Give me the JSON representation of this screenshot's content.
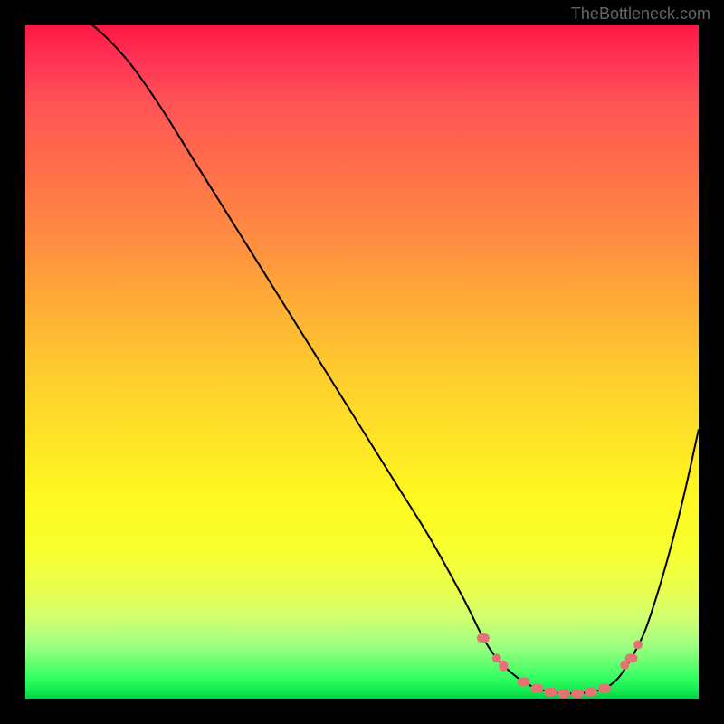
{
  "watermark": "TheBottleneck.com",
  "chart_data": {
    "type": "line",
    "title": "",
    "xlabel": "",
    "ylabel": "",
    "xlim": [
      0,
      100
    ],
    "ylim": [
      0,
      100
    ],
    "curve": {
      "description": "Bottleneck percentage curve",
      "x": [
        0,
        5,
        10,
        15,
        20,
        25,
        30,
        35,
        40,
        45,
        50,
        55,
        60,
        65,
        68,
        70,
        72,
        74,
        76,
        78,
        80,
        82,
        84,
        86,
        88,
        90,
        92,
        94,
        96,
        98,
        100
      ],
      "y": [
        105,
        103,
        100,
        95,
        88,
        80,
        72,
        64,
        56,
        48,
        40,
        32,
        24,
        15,
        9,
        6,
        4,
        2.5,
        1.5,
        1,
        0.8,
        0.8,
        1,
        1.5,
        3,
        6,
        10,
        16,
        23,
        31,
        40
      ]
    },
    "markers": {
      "description": "Red marker points on optimal zone",
      "points": [
        {
          "x": 68,
          "y": 9,
          "type": "capsule"
        },
        {
          "x": 70,
          "y": 6,
          "type": "dot"
        },
        {
          "x": 71,
          "y": 5,
          "type": "capsule_small"
        },
        {
          "x": 74,
          "y": 2.5,
          "type": "capsule"
        },
        {
          "x": 76,
          "y": 1.5,
          "type": "capsule"
        },
        {
          "x": 78,
          "y": 1,
          "type": "capsule"
        },
        {
          "x": 80,
          "y": 0.8,
          "type": "capsule"
        },
        {
          "x": 82,
          "y": 0.8,
          "type": "capsule"
        },
        {
          "x": 84,
          "y": 1,
          "type": "capsule"
        },
        {
          "x": 86,
          "y": 1.5,
          "type": "capsule"
        },
        {
          "x": 89,
          "y": 5,
          "type": "dot"
        },
        {
          "x": 90,
          "y": 6,
          "type": "capsule"
        },
        {
          "x": 91,
          "y": 8,
          "type": "dot"
        }
      ]
    },
    "colors": {
      "background_gradient_top": "#ff1744",
      "background_gradient_bottom": "#00d040",
      "curve_color": "#000000",
      "marker_color": "#e57373",
      "frame_color": "#000000"
    }
  }
}
